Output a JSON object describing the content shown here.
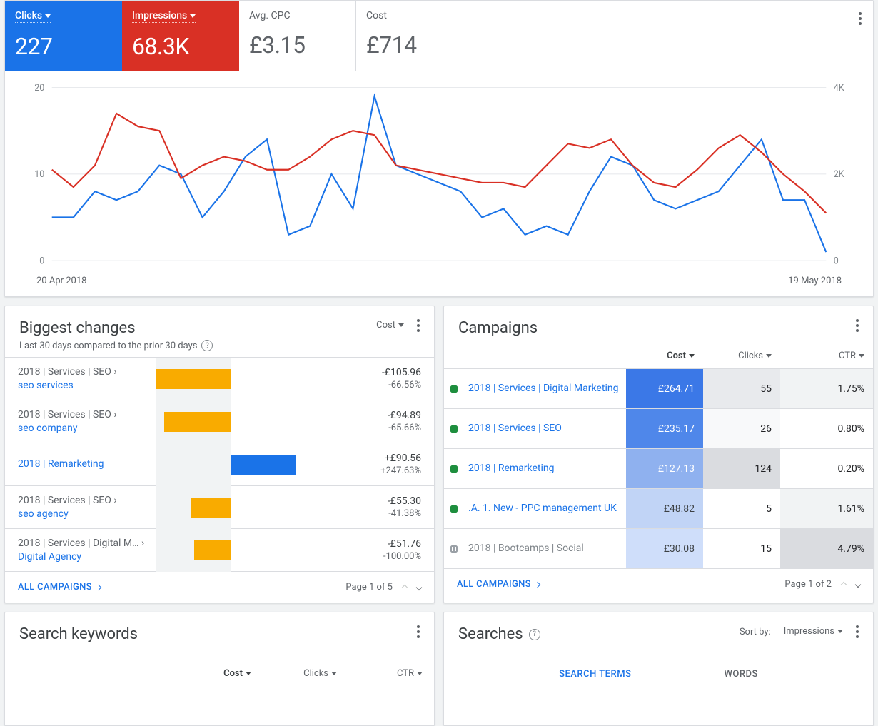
{
  "metrics": [
    {
      "label": "Clicks",
      "value": "227",
      "style": "blue"
    },
    {
      "label": "Impressions",
      "value": "68.3K",
      "style": "red"
    },
    {
      "label": "Avg. CPC",
      "value": "£3.15",
      "style": "plain"
    },
    {
      "label": "Cost",
      "value": "£714",
      "style": "plain"
    }
  ],
  "chart_data": {
    "type": "line",
    "x_start": "20 Apr 2018",
    "x_end": "19 May 2018",
    "left_axis": {
      "label": "Clicks",
      "ticks": [
        0,
        10,
        20
      ],
      "max": 20
    },
    "right_axis": {
      "label": "Impressions",
      "ticks": [
        0,
        "2K",
        "4K"
      ],
      "max": 4000
    },
    "series": [
      {
        "name": "Clicks",
        "axis": "left",
        "color": "#1a73e8",
        "values": [
          5,
          5,
          8,
          7,
          8,
          11,
          10,
          5,
          8,
          12,
          14,
          3,
          4,
          10,
          6,
          19,
          11,
          10,
          9,
          8,
          5,
          6,
          3,
          4,
          3,
          8,
          12,
          11,
          7,
          6,
          7,
          8,
          11,
          14,
          7,
          7,
          1
        ]
      },
      {
        "name": "Impressions",
        "axis": "right",
        "color": "#d93025",
        "values": [
          2100,
          1700,
          2200,
          3400,
          3100,
          3000,
          1900,
          2200,
          2400,
          2300,
          2100,
          2100,
          2400,
          2800,
          3000,
          2900,
          2200,
          2100,
          2000,
          1900,
          1800,
          1800,
          1700,
          2200,
          2700,
          2600,
          2800,
          2200,
          1800,
          1700,
          2100,
          2600,
          2900,
          2500,
          2000,
          1600,
          1100
        ]
      }
    ]
  },
  "biggest_changes": {
    "title": "Biggest changes",
    "subtitle": "Last 30 days compared to the prior 30 days",
    "sort": "Cost",
    "rows": [
      {
        "crumb": "2018 | Services | SEO ›",
        "link": "seo services",
        "delta": "-£105.96",
        "pct": "-66.56%",
        "dir": "neg",
        "bar": 100
      },
      {
        "crumb": "2018 | Services | SEO ›",
        "link": "seo company",
        "delta": "-£94.89",
        "pct": "-65.66%",
        "dir": "neg",
        "bar": 90
      },
      {
        "crumb": "",
        "link": "2018 | Remarketing",
        "delta": "+£90.56",
        "pct": "+247.63%",
        "dir": "pos",
        "bar": 86
      },
      {
        "crumb": "2018 | Services | SEO ›",
        "link": "seo agency",
        "delta": "-£55.30",
        "pct": "-41.38%",
        "dir": "neg",
        "bar": 53
      },
      {
        "crumb": "2018 | Services | Digital M… ›",
        "link": "Digital Agency",
        "delta": "-£51.76",
        "pct": "-100.00%",
        "dir": "neg",
        "bar": 50
      }
    ],
    "all_link": "ALL CAMPAIGNS",
    "pager": "Page 1 of 5"
  },
  "campaigns": {
    "title": "Campaigns",
    "columns": [
      "Cost",
      "Clicks",
      "CTR"
    ],
    "rows": [
      {
        "status": "enabled",
        "name": "2018 | Services | Digital Marketing",
        "cost": "£264.71",
        "clicks": "55",
        "ctr": "1.75%",
        "costShade": "#3b78e7",
        "clicksShade": "#e8eaed",
        "ctrShade": "#f1f3f4"
      },
      {
        "status": "enabled",
        "name": "2018 | Services | SEO",
        "cost": "£235.17",
        "clicks": "26",
        "ctr": "0.80%",
        "costShade": "#4f87ea",
        "clicksShade": "#f8f9fa",
        "ctrShade": "#fff"
      },
      {
        "status": "enabled",
        "name": "2018 | Remarketing",
        "cost": "£127.13",
        "clicks": "124",
        "ctr": "0.20%",
        "costShade": "#8fb1ef",
        "clicksShade": "#dadce0",
        "ctrShade": "#fff"
      },
      {
        "status": "enabled",
        "name": ".A. 1. New - PPC management UK",
        "cost": "£48.82",
        "clicks": "5",
        "ctr": "1.61%",
        "costShade": "#c1d4f6",
        "clicksShade": "#fff",
        "ctrShade": "#f1f3f4"
      },
      {
        "status": "paused",
        "name": "2018 | Bootcamps | Social",
        "cost": "£30.08",
        "clicks": "15",
        "ctr": "4.79%",
        "costShade": "#cfdefa",
        "clicksShade": "#fff",
        "ctrShade": "#dadce0"
      }
    ],
    "all_link": "ALL CAMPAIGNS",
    "pager": "Page 1 of 2"
  },
  "search_keywords": {
    "title": "Search keywords",
    "columns": [
      "Cost",
      "Clicks",
      "CTR"
    ]
  },
  "searches": {
    "title": "Searches",
    "sort_label": "Sort by:",
    "sort_value": "Impressions",
    "tabs": [
      "SEARCH TERMS",
      "WORDS"
    ]
  }
}
